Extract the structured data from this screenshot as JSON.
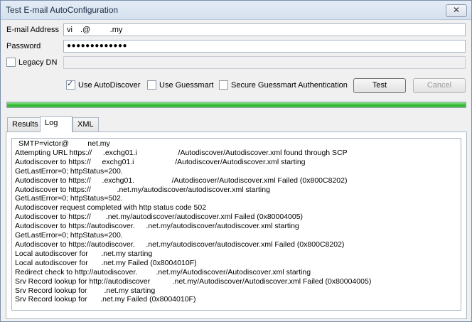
{
  "window": {
    "title": "Test E-mail AutoConfiguration",
    "close_glyph": "✕"
  },
  "form": {
    "email_label": "E-mail Address",
    "email_value": "vi  .@     .my",
    "password_label": "Password",
    "password_value": "●●●●●●●●●●●●●",
    "legacy_dn_label": "Legacy DN",
    "legacy_dn_checked": false,
    "legacy_dn_value": ""
  },
  "options": {
    "use_autodiscover": {
      "label": "Use AutoDiscover",
      "checked": true
    },
    "use_guessmart": {
      "label": "Use Guessmart",
      "checked": false
    },
    "secure_guessmart": {
      "label": "Secure Guessmart Authentication",
      "checked": false
    }
  },
  "buttons": {
    "test": "Test",
    "cancel": "Cancel"
  },
  "progress": {
    "fraction": 1.0,
    "color": "#2fb52f"
  },
  "tabs": [
    {
      "label": "Results"
    },
    {
      "label": "Log",
      "active": true
    },
    {
      "label": "XML"
    }
  ],
  "log": [
    "SMTP=victor@     net.my",
    "Attempting URL https://   .exchg01.i           /Autodiscover/Autodiscover.xml found through SCP",
    "Autodiscover to https://   exchg01.i           /Autodiscover/Autodiscover.xml starting",
    "GetLastError=0; httpStatus=200.",
    "Autodiscover to https://   .exchg01.          /Autodiscover/Autodiscover.xml Failed (0x800C8202)",
    "Autodiscover to https://       .net.my/autodiscover/autodiscover.xml starting",
    "GetLastError=0; httpStatus=502.",
    "Autodiscover request completed with http status code 502",
    "Autodiscover to https://    .net.my/autodiscover/autodiscover.xml Failed (0x80004005)",
    "Autodiscover to https://autodiscover.   .net.my/autodiscover/autodiscover.xml starting",
    "GetLastError=0; httpStatus=200.",
    "Autodiscover to https://autodiscover.   .net.my/autodiscover/autodiscover.xml Failed (0x800C8202)",
    "Local autodiscover for    .net.my starting",
    "Local autodiscover for    .net.my Failed (0x8004010F)",
    "Redirect check to http://autodiscover.     .net.my/Autodiscover/Autodiscover.xml starting",
    "Srv Record lookup for http://autodiscover      .net.my/Autodiscover/Autodiscover.xml Failed (0x80004005)",
    "Srv Record lookup for     .net.my starting",
    "Srv Record lookup for    .net.my Failed (0x8004010F)"
  ]
}
